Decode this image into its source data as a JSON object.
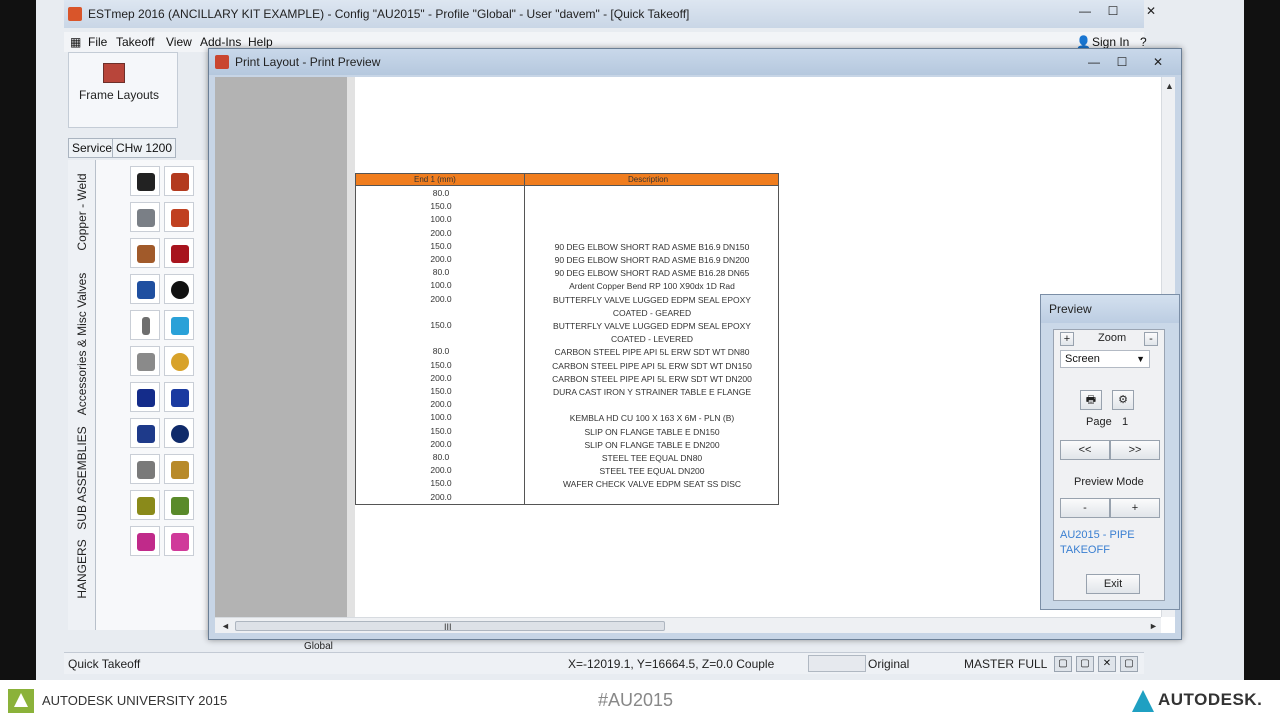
{
  "app": {
    "title": "ESTmep 2016 (ANCILLARY KIT EXAMPLE) - Config \"AU2015\" - Profile \"Global\" - User \"davem\" - [Quick Takeoff]",
    "minimize": "—",
    "maximize": "☐",
    "close": "✕",
    "sign_in": "Sign In",
    "help": "?"
  },
  "menu": {
    "file": "File",
    "takeoff": "Takeoff",
    "view": "View",
    "addins": "Add-Ins",
    "help": "Help"
  },
  "ribbon": {
    "frame_layouts": "Frame Layouts"
  },
  "service_tabs": {
    "service": "Service",
    "chw": "CHw 1200"
  },
  "vertical_tabs": {
    "copper": "Copper - Weld",
    "accessories": "Accessories & Misc Valves",
    "subassemblies": "SUB ASSEMBLIES",
    "hangers": "HANGERS"
  },
  "print_layout": {
    "title": "Print Layout - Print Preview",
    "minimize": "—",
    "maximize": "☐",
    "close": "✕",
    "scroll_up": "▲",
    "scroll_left": "◄",
    "scroll_right": "►",
    "grip": "III"
  },
  "report": {
    "headers": {
      "col1": "End 1 (mm)",
      "col2": "Description"
    },
    "rows": [
      {
        "size": "80.0",
        "desc": ""
      },
      {
        "size": "150.0",
        "desc": ""
      },
      {
        "size": "100.0",
        "desc": ""
      },
      {
        "size": "200.0",
        "desc": ""
      },
      {
        "size": "150.0",
        "desc": "90 DEG ELBOW SHORT RAD ASME B16.9 DN150"
      },
      {
        "size": "200.0",
        "desc": "90 DEG ELBOW SHORT RAD ASME B16.9 DN200"
      },
      {
        "size": "80.0",
        "desc": "90 DEG ELBOW SHORT RAD ASME B16.28 DN65"
      },
      {
        "size": "100.0",
        "desc": "Ardent Copper Bend RP 100 X90dx 1D Rad"
      },
      {
        "size": "200.0",
        "desc": "BUTTERFLY VALVE LUGGED EDPM SEAL EPOXY"
      },
      {
        "size": "",
        "desc": "COATED - GEARED"
      },
      {
        "size": "150.0",
        "desc": "BUTTERFLY VALVE LUGGED EDPM SEAL EPOXY"
      },
      {
        "size": "",
        "desc": "COATED - LEVERED"
      },
      {
        "size": "80.0",
        "desc": "CARBON STEEL PIPE API 5L ERW SDT WT DN80"
      },
      {
        "size": "150.0",
        "desc": "CARBON STEEL PIPE API 5L ERW SDT WT DN150"
      },
      {
        "size": "200.0",
        "desc": "CARBON STEEL PIPE API 5L ERW SDT WT DN200"
      },
      {
        "size": "150.0",
        "desc": "DURA CAST IRON Y STRAINER TABLE E FLANGE"
      },
      {
        "size": "200.0",
        "desc": ""
      },
      {
        "size": "100.0",
        "desc": "KEMBLA HD CU 100 X 163 X 6M - PLN (B)"
      },
      {
        "size": "150.0",
        "desc": "SLIP ON FLANGE TABLE E DN150"
      },
      {
        "size": "200.0",
        "desc": "SLIP ON FLANGE TABLE E DN200"
      },
      {
        "size": "80.0",
        "desc": "STEEL TEE EQUAL DN80"
      },
      {
        "size": "200.0",
        "desc": "STEEL TEE EQUAL DN200"
      },
      {
        "size": "150.0",
        "desc": "WAFER CHECK VALVE EDPM SEAT SS DISC"
      },
      {
        "size": "200.0",
        "desc": ""
      }
    ]
  },
  "preview": {
    "title": "Preview",
    "zoom_label": "Zoom",
    "zoom_in": "+",
    "zoom_out": "-",
    "zoom_value": "Screen",
    "dropdown": "▼",
    "page_label": "Page",
    "page_value": "1",
    "prev": "<<",
    "next": ">>",
    "mode_label": "Preview Mode",
    "mode_minus": "-",
    "mode_plus": "+",
    "layout_link": "AU2015 - PIPE TAKEOFF",
    "exit": "Exit"
  },
  "status": {
    "left": "Quick Takeoff",
    "coords": "X=-12019.1, Y=16664.5, Z=0.0 Couple",
    "original": "Original",
    "master": "MASTER",
    "full": "FULL",
    "bottom_tab": "Global"
  },
  "footer": {
    "au": "AUTODESK UNIVERSITY 2015",
    "hashtag": "#AU2015",
    "autodesk": "AUTODESK."
  },
  "colors": {
    "report_header": "#f07d1e",
    "link": "#3a7fd1",
    "au_green": "#8bb23a",
    "autodesk_blue": "#1fa0c2"
  }
}
